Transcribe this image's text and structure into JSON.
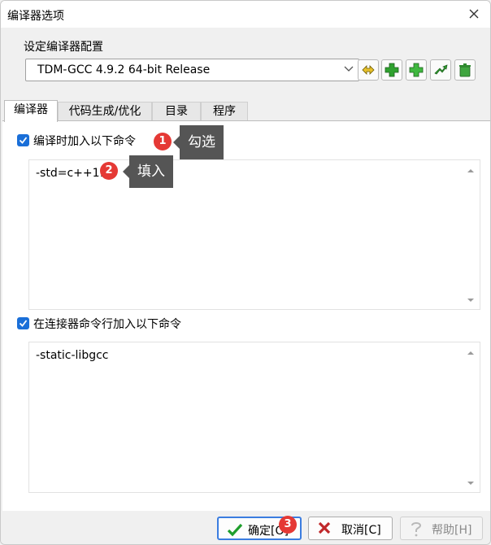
{
  "window": {
    "title": "编译器选项"
  },
  "config_group": {
    "label": "设定编译器配置",
    "selected": "TDM-GCC 4.9.2 64-bit Release"
  },
  "toolbar": [
    {
      "name": "rename-config-icon"
    },
    {
      "name": "add-config-icon"
    },
    {
      "name": "copy-config-icon"
    },
    {
      "name": "convert-config-icon"
    },
    {
      "name": "delete-config-icon"
    }
  ],
  "tabs": [
    "编译器",
    "代码生成/优化",
    "目录",
    "程序"
  ],
  "compiler": {
    "compile_check_label": "编译时加入以下命令",
    "compile_commands": "-std=c++11",
    "linker_check_label": "在连接器命令行加入以下命令",
    "linker_commands": "-static-libgcc"
  },
  "annotations": {
    "n1": "1",
    "t1": "勾选",
    "n2": "2",
    "t2": "填入",
    "n3": "3"
  },
  "buttons": {
    "ok": "确定[O]",
    "cancel": "取消[C]",
    "help": "帮助[H]"
  },
  "colors": {
    "accent": "#1a6fd8",
    "badge": "#e53935",
    "callout": "#555555"
  }
}
